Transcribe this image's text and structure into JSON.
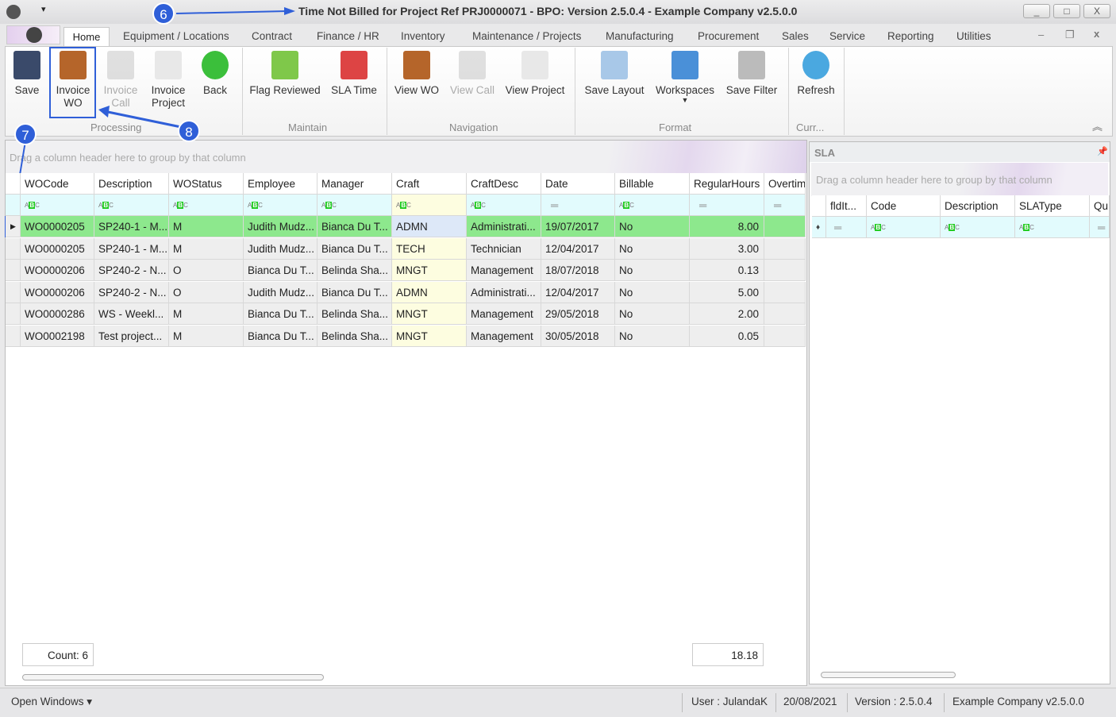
{
  "window": {
    "title": "Time Not Billed for Project Ref PRJ0000071 - BPO: Version 2.5.0.4 - Example Company v2.5.0.0",
    "min": "_",
    "max": "□",
    "close": "X"
  },
  "tabs": [
    "Home",
    "Equipment / Locations",
    "Contract",
    "Finance / HR",
    "Inventory",
    "Maintenance / Projects",
    "Manufacturing",
    "Procurement",
    "Sales",
    "Service",
    "Reporting",
    "Utilities"
  ],
  "ribbon": {
    "buttons": [
      {
        "label": "Save",
        "icon": "floppy-disk-icon",
        "enabled": true
      },
      {
        "label": "Invoice WO",
        "icon": "briefcase-document-icon",
        "enabled": true
      },
      {
        "label": "Invoice Call",
        "icon": "document-gray-icon",
        "enabled": false
      },
      {
        "label": "Invoice Project",
        "icon": "document-plus-icon",
        "enabled": true
      },
      {
        "label": "Back",
        "icon": "back-arrow-icon",
        "enabled": true
      },
      {
        "label": "Flag Reviewed",
        "icon": "flag-icon",
        "enabled": true
      },
      {
        "label": "SLA Time",
        "icon": "calendar-clock-icon",
        "enabled": true
      },
      {
        "label": "View WO",
        "icon": "briefcase-document-icon",
        "enabled": true
      },
      {
        "label": "View Call",
        "icon": "document-gray-icon",
        "enabled": false
      },
      {
        "label": "View Project",
        "icon": "document-plus-icon",
        "enabled": true
      },
      {
        "label": "Save Layout",
        "icon": "layout-wrench-icon",
        "enabled": true
      },
      {
        "label": "Workspaces",
        "icon": "grid-icon",
        "enabled": true
      },
      {
        "label": "Save Filter",
        "icon": "funnel-icon",
        "enabled": true
      },
      {
        "label": "Refresh",
        "icon": "refresh-icon",
        "enabled": true
      }
    ],
    "groups": [
      "Processing",
      "Maintain",
      "Navigation",
      "Format",
      "Curr..."
    ]
  },
  "grid": {
    "group_hint": "Drag a column header here to group by that column",
    "columns": [
      "WOCode",
      "Description",
      "WOStatus",
      "Employee",
      "Manager",
      "Craft",
      "CraftDesc",
      "Date",
      "Billable",
      "RegularHours",
      "Overtim"
    ],
    "rows": [
      [
        "WO0000205",
        "SP240-1 - M...",
        "M",
        "Judith Mudz...",
        "Bianca Du T...",
        "ADMN",
        "Administrati...",
        "19/07/2017",
        "No",
        "8.00",
        ""
      ],
      [
        "WO0000205",
        "SP240-1 - M...",
        "M",
        "Judith Mudz...",
        "Bianca Du T...",
        "TECH",
        "Technician",
        "12/04/2017",
        "No",
        "3.00",
        ""
      ],
      [
        "WO0000206",
        "SP240-2 - N...",
        "O",
        "Bianca Du T...",
        "Belinda Sha...",
        "MNGT",
        "Management",
        "18/07/2018",
        "No",
        "0.13",
        ""
      ],
      [
        "WO0000206",
        "SP240-2 - N...",
        "O",
        "Judith Mudz...",
        "Bianca Du T...",
        "ADMN",
        "Administrati...",
        "12/04/2017",
        "No",
        "5.00",
        ""
      ],
      [
        "WO0000286",
        "WS - Weekl...",
        "M",
        "Bianca Du T...",
        "Belinda Sha...",
        "MNGT",
        "Management",
        "29/05/2018",
        "No",
        "2.00",
        ""
      ],
      [
        "WO0002198",
        "Test project...",
        "M",
        "Bianca Du T...",
        "Belinda Sha...",
        "MNGT",
        "Management",
        "30/05/2018",
        "No",
        "0.05",
        ""
      ]
    ],
    "count": "Count: 6",
    "total_regular_hours": "18.18"
  },
  "sla": {
    "title": "SLA",
    "group_hint": "Drag a column header here to group by that column",
    "columns": [
      "fldIt...",
      "Code",
      "Description",
      "SLAType",
      "Qu"
    ]
  },
  "status": {
    "open_windows": "Open Windows",
    "user": "User : JulandaK",
    "date": "20/08/2021",
    "version": "Version : 2.5.0.4",
    "company": "Example Company v2.5.0.0"
  },
  "annotations": [
    "6",
    "7",
    "8"
  ],
  "colors": {
    "selected_row": "#8de88d",
    "filter_row": "#e2fbfd",
    "craft_column": "#fdfde0",
    "annotation": "#2f5fd8"
  }
}
